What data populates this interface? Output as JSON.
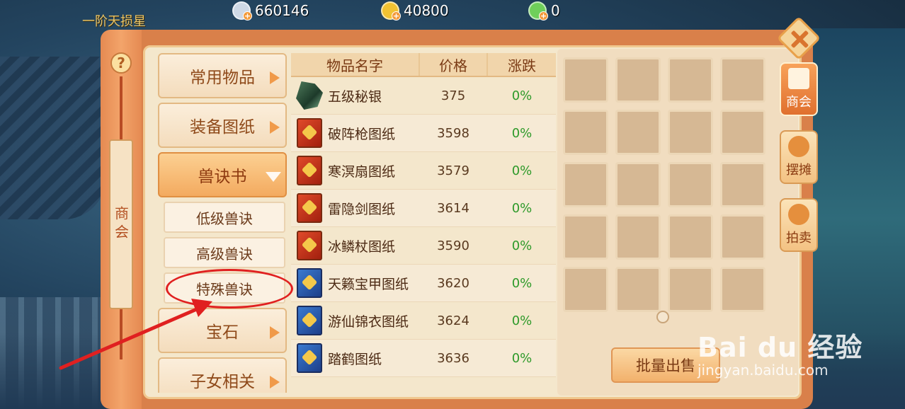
{
  "header": {
    "title": "一阶天损星",
    "currencies": [
      {
        "icon": "silver-coin-icon",
        "value": "660146",
        "color": "#cfd9e6"
      },
      {
        "icon": "gold-coin-icon",
        "value": "40800",
        "color": "#f1c232"
      },
      {
        "icon": "jade-coin-icon",
        "value": "0",
        "color": "#6fcf5a"
      }
    ]
  },
  "left_rail": {
    "help_label": "?",
    "tab_label": "商会"
  },
  "categories": {
    "common": "常用物品",
    "equipment_drawings": "装备图纸",
    "beast_books": "兽诀书",
    "low_beast": "低级兽诀",
    "high_beast": "高级兽诀",
    "special_beast": "特殊兽诀",
    "gems": "宝石",
    "children": "子女相关"
  },
  "table": {
    "headers": {
      "name": "物品名字",
      "price": "价格",
      "change": "涨跌"
    },
    "rows": [
      {
        "name": "五级秘银",
        "price": "375",
        "change": "0%",
        "icon": "ore-icon"
      },
      {
        "name": "破阵枪图纸",
        "price": "3598",
        "change": "0%",
        "icon": "red-book-icon"
      },
      {
        "name": "寒溟扇图纸",
        "price": "3579",
        "change": "0%",
        "icon": "red-book-icon"
      },
      {
        "name": "雷隐剑图纸",
        "price": "3614",
        "change": "0%",
        "icon": "red-book-icon"
      },
      {
        "name": "冰鳞杖图纸",
        "price": "3590",
        "change": "0%",
        "icon": "red-book-icon"
      },
      {
        "name": "天籁宝甲图纸",
        "price": "3620",
        "change": "0%",
        "icon": "blue-book-icon"
      },
      {
        "name": "游仙锦衣图纸",
        "price": "3624",
        "change": "0%",
        "icon": "blue-book-icon"
      },
      {
        "name": "踏鹤图纸",
        "price": "3636",
        "change": "0%",
        "icon": "blue-book-icon"
      }
    ]
  },
  "sell_panel": {
    "batch_sell": "批量出售"
  },
  "right_tabs": {
    "chamber": "商会",
    "stall": "摆摊",
    "auction": "拍卖"
  },
  "colors": {
    "accent": "#e58a52",
    "change_green": "#2e9a2a",
    "annotation_red": "#e02020"
  },
  "watermark": {
    "logo": "Bai du 经验",
    "url": "jingyan.baidu.com"
  }
}
